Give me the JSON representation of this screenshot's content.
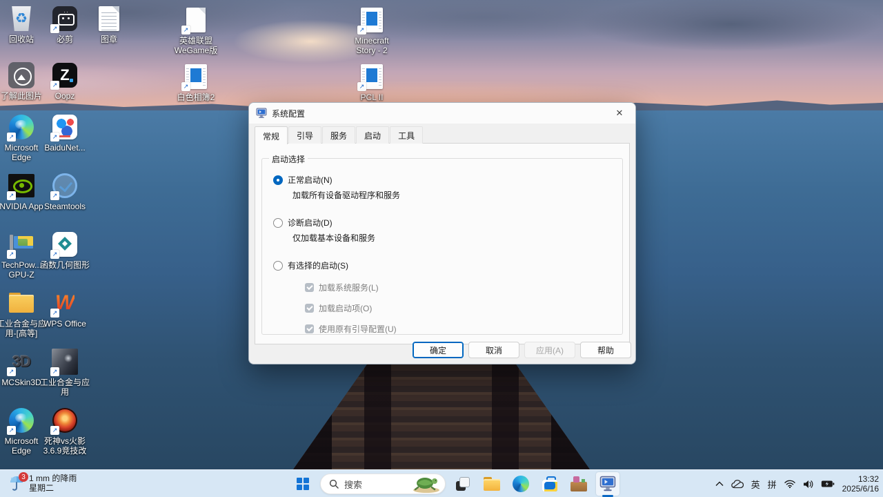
{
  "desktop": {
    "icons": [
      {
        "label": "回收站",
        "glyph": "♻"
      },
      {
        "label": "必剪"
      },
      {
        "label": "图章"
      },
      {
        "label": "英雄联盟\nWeGame版"
      },
      {
        "label": "Minecraft\nStory - 2"
      },
      {
        "label": "了解此图片"
      },
      {
        "label": "Oopz",
        "glyph": "Z"
      },
      {
        "label": "白色相簿2"
      },
      {
        "label": "PCL II"
      },
      {
        "label": "Microsoft\nEdge"
      },
      {
        "label": "BaiduNet..."
      },
      {
        "label": "NVIDIA App"
      },
      {
        "label": "Steamtools"
      },
      {
        "label": "TechPow...\nGPU-Z"
      },
      {
        "label": "函数几何图形"
      },
      {
        "label": "工业合金与应\n用-[高等]"
      },
      {
        "label": "WPS Office",
        "glyph": "W"
      },
      {
        "label": "MCSkin3D",
        "glyph": "3D"
      },
      {
        "label": "工业合金与应\n用"
      },
      {
        "label": "Microsoft\nEdge"
      },
      {
        "label": "死神vs火影\n3.6.9竞技改"
      }
    ]
  },
  "dialog": {
    "title": "系统配置",
    "close_glyph": "✕",
    "tabs": [
      "常规",
      "引导",
      "服务",
      "启动",
      "工具"
    ],
    "group_title": "启动选择",
    "radios": [
      {
        "label": "正常启动(N)",
        "desc": "加载所有设备驱动程序和服务"
      },
      {
        "label": "诊断启动(D)",
        "desc": "仅加载基本设备和服务"
      },
      {
        "label": "有选择的启动(S)"
      }
    ],
    "checkboxes": [
      "加载系统服务(L)",
      "加载启动项(O)",
      "使用原有引导配置(U)"
    ],
    "buttons": {
      "ok": "确定",
      "cancel": "取消",
      "apply": "应用(A)",
      "help": "帮助"
    }
  },
  "taskbar": {
    "widget": {
      "badge": "3",
      "line1": "1 mm 的降雨",
      "line2": "星期二"
    },
    "search_placeholder": "搜索",
    "tray": {
      "ime_lang": "英",
      "ime_mode": "拼",
      "time": "13:32",
      "date": "2025/6/16"
    }
  }
}
